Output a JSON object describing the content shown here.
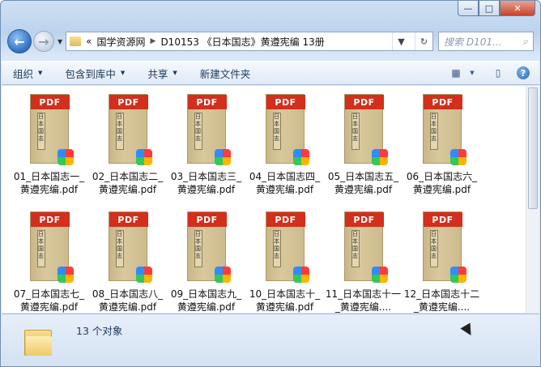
{
  "window": {
    "minimize_glyph": "—",
    "maximize_glyph": "□",
    "close_glyph": "✕"
  },
  "nav": {
    "back_glyph": "←",
    "forward_glyph": "→",
    "history_glyph": "▼",
    "breadcrumb_overflow": "«",
    "breadcrumb": [
      "国学资源网",
      "D10153 《日本国志》黄遵宪编 13册"
    ],
    "breadcrumb_sep": "▶",
    "dropdown_glyph": "▼",
    "refresh_glyph": "↻",
    "search_placeholder": "搜索 D101...",
    "search_icon": "⌕"
  },
  "toolbar": {
    "organize": "组织",
    "include": "包含到库中",
    "share": "共享",
    "new_folder": "新建文件夹",
    "dropdown_glyph": "▼",
    "view_glyph": "▦",
    "pane_glyph": "▯",
    "help_glyph": "?"
  },
  "thumb": {
    "pdf_label": "PDF",
    "cover_title": "日本国志",
    "badge_text": "PDF"
  },
  "files": [
    "01_日本国志一_黄遵宪编.pdf",
    "02_日本国志二_黄遵宪编.pdf",
    "03_日本国志三_黄遵宪编.pdf",
    "04_日本国志四_黄遵宪编.pdf",
    "05_日本国志五_黄遵宪编.pdf",
    "06_日本国志六_黄遵宪编.pdf",
    "07_日本国志七_黄遵宪编.pdf",
    "08_日本国志八_黄遵宪编.pdf",
    "09_日本国志九_黄遵宪编.pdf",
    "10_日本国志十_黄遵宪编.pdf",
    "11_日本国志十一_黄遵宪编....",
    "12_日本国志十二_黄遵宪编...."
  ],
  "status": {
    "count": "13 个对象"
  },
  "colors": {
    "pdf_red": "#d22f1c",
    "cover_tan": "#d8c89c",
    "toolbar_text": "#1e395b"
  }
}
